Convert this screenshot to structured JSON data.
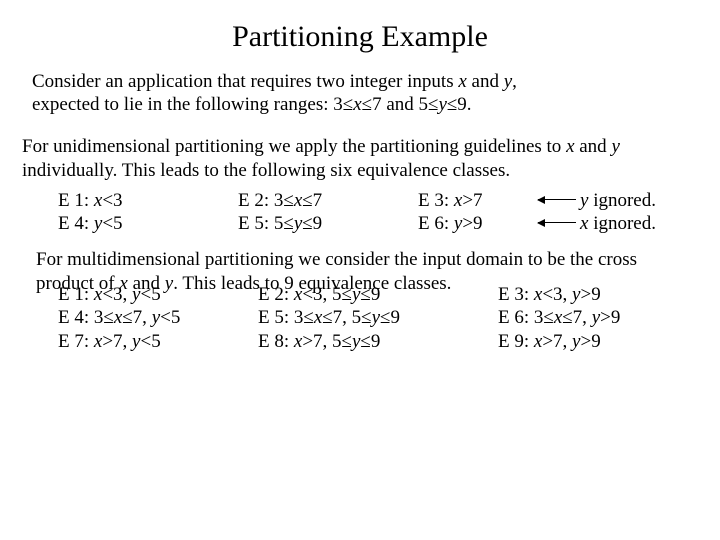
{
  "title": "Partitioning Example",
  "intro": {
    "line1_a": "Consider an application that requires two integer inputs ",
    "line1_b": " and ",
    "line1_c": ",",
    "line2_a": "expected to lie in the following ranges: 3≤",
    "line2_b": "≤7 and 5≤",
    "line2_c": "≤9.",
    "x": "x",
    "y": "y"
  },
  "uni": {
    "p_a": "For unidimensional partitioning we apply the partitioning guidelines to ",
    "p_b": " and ",
    "p_c": " individually. This leads to the following six equivalence classes.",
    "x": "x ",
    "y": "y",
    "rows": [
      {
        "c1_l": "E 1: ",
        "c1_v": "x",
        "c1_r": "<3",
        "c2_l": "E 2: 3≤",
        "c2_v": "x",
        "c2_r": "≤7",
        "c3_l": "E 3: ",
        "c3_v": "x",
        "c3_r": ">7",
        "note_v": "y",
        "note_r": " ignored."
      },
      {
        "c1_l": "E 4: ",
        "c1_v": "y",
        "c1_r": "<5",
        "c2_l": "E 5: 5≤",
        "c2_v": "y",
        "c2_r": "≤9",
        "c3_l": "E 6: ",
        "c3_v": "y",
        "c3_r": ">9",
        "note_v": "x",
        "note_r": " ignored."
      }
    ]
  },
  "multi": {
    "p_a": "For multidimensional partitioning we consider the input domain to be the cross product of ",
    "p_b": " and ",
    "p_c": ". This leads to 9 equivalence classes.",
    "x": "x",
    "y": "y",
    "cells": {
      "e1_a": "E 1: ",
      "e1_x": "x",
      "e1_b": "<3, ",
      "e1_y": "y",
      "e1_c": "<5",
      "e2_a": "E 2: ",
      "e2_x": "x",
      "e2_b": "<3, 5≤",
      "e2_y": "y",
      "e2_c": "≤9",
      "e3_a": "E 3: ",
      "e3_x": "x",
      "e3_b": "<3, ",
      "e3_y": "y",
      "e3_c": ">9",
      "e4_a": "E 4: 3≤",
      "e4_x": "x",
      "e4_b": "≤7, ",
      "e4_y": "y",
      "e4_c": "<5",
      "e5_a": "E 5: 3≤",
      "e5_x": "x",
      "e5_b": "≤7,  5≤",
      "e5_y": "y",
      "e5_c": "≤9",
      "e6_a": "E 6: 3≤",
      "e6_x": "x",
      "e6_b": "≤7, ",
      "e6_y": "y",
      "e6_c": ">9",
      "e7_a": "E 7: ",
      "e7_x": "x",
      "e7_b": ">7, ",
      "e7_y": "y",
      "e7_c": "<5",
      "e8_a": "E 8: ",
      "e8_x": "x",
      "e8_b": ">7,  5≤",
      "e8_y": "y",
      "e8_c": "≤9",
      "e9_a": "E 9: ",
      "e9_x": "x",
      "e9_b": ">7, ",
      "e9_y": "y",
      "e9_c": ">9"
    }
  }
}
